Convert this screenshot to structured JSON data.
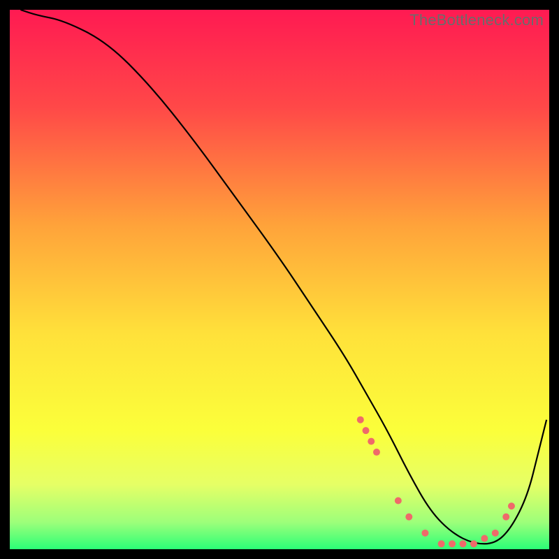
{
  "watermark": "TheBottleneck.com",
  "chart_data": {
    "type": "line",
    "title": "",
    "xlabel": "",
    "ylabel": "",
    "xlim": [
      0,
      100
    ],
    "ylim": [
      0,
      100
    ],
    "background_gradient": {
      "stops": [
        {
          "offset": 0,
          "color": "#ff1a52"
        },
        {
          "offset": 18,
          "color": "#ff4848"
        },
        {
          "offset": 40,
          "color": "#ffa33a"
        },
        {
          "offset": 60,
          "color": "#ffe13a"
        },
        {
          "offset": 78,
          "color": "#fbff3a"
        },
        {
          "offset": 88,
          "color": "#e6ff66"
        },
        {
          "offset": 95,
          "color": "#9dff7a"
        },
        {
          "offset": 100,
          "color": "#2bff77"
        }
      ]
    },
    "series": [
      {
        "name": "bottleneck-curve",
        "color": "#000000",
        "x": [
          2,
          5,
          10,
          18,
          26,
          34,
          42,
          50,
          56,
          62,
          66,
          70,
          74,
          78,
          82,
          86,
          90,
          93,
          96,
          98,
          99.5
        ],
        "values": [
          100,
          99,
          98,
          94,
          86,
          76,
          65,
          54,
          45,
          36,
          29,
          22,
          14,
          7,
          3,
          1,
          1,
          4,
          10,
          18,
          24
        ]
      }
    ],
    "markers": {
      "name": "highlight-dots",
      "color": "#ef6a6a",
      "x": [
        65,
        66,
        67,
        68,
        72,
        74,
        77,
        80,
        82,
        84,
        86,
        88,
        90,
        92,
        93
      ],
      "values": [
        24,
        22,
        20,
        18,
        9,
        6,
        3,
        1,
        1,
        1,
        1,
        2,
        3,
        6,
        8
      ]
    }
  }
}
